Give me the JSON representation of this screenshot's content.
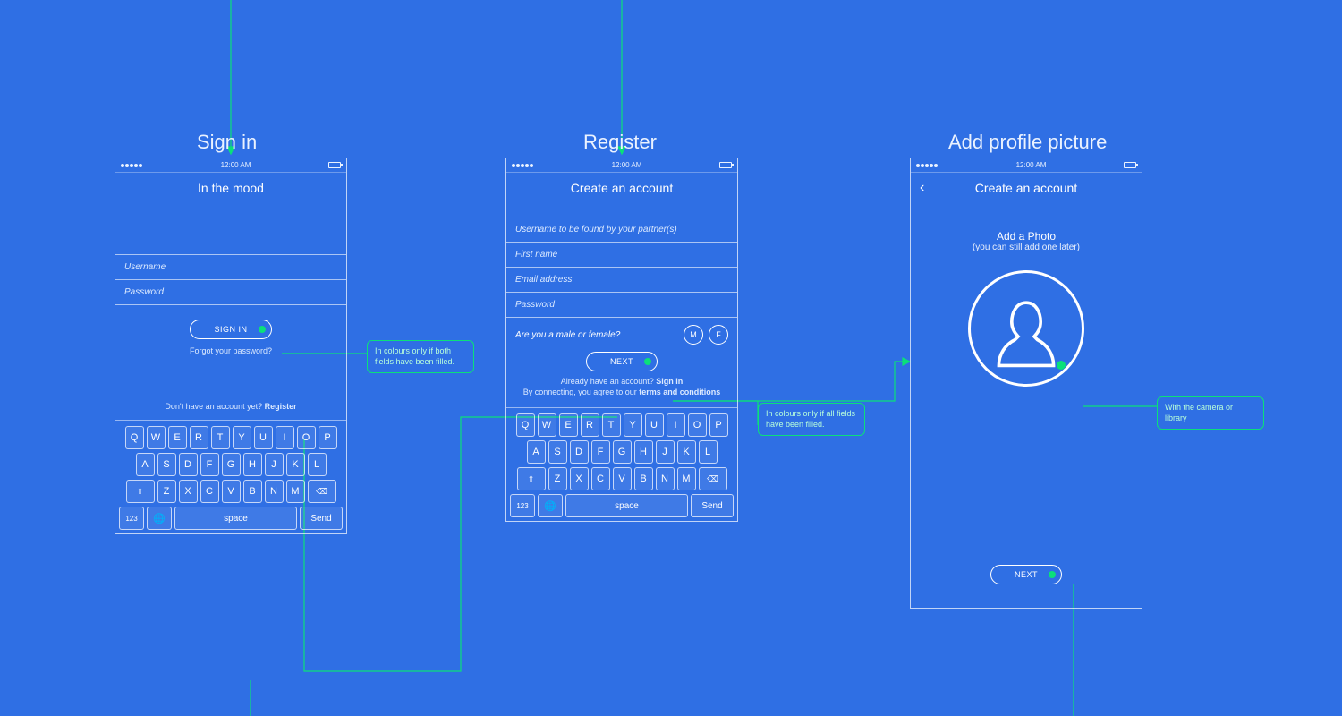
{
  "statusbar": {
    "time": "12:00 AM"
  },
  "screens": {
    "signin": {
      "title": "Sign in",
      "header": "In the mood",
      "fields": {
        "username": "Username",
        "password": "Password"
      },
      "signin_btn": "SIGN IN",
      "forgot": "Forgot your password?",
      "no_account_prefix": "Don't have an account yet? ",
      "no_account_link": "Register"
    },
    "register": {
      "title": "Register",
      "header": "Create an account",
      "fields": {
        "username": "Username to be found by your partner(s)",
        "firstname": "First name",
        "email": "Email address",
        "password": "Password"
      },
      "gender_q": "Are you a male or female?",
      "gender_m": "M",
      "gender_f": "F",
      "next_btn": "NEXT",
      "have_account_prefix": "Already have an account? ",
      "have_account_link": "Sign in",
      "terms_prefix": "By connecting, you agree to our ",
      "terms_link": "terms and conditions"
    },
    "photo": {
      "title": "Add profile picture",
      "header": "Create an account",
      "add_photo": "Add a Photo",
      "add_photo_sub": "(you can still add one later)",
      "next_btn": "NEXT"
    }
  },
  "keyboard": {
    "row1": [
      "Q",
      "W",
      "E",
      "R",
      "T",
      "Y",
      "U",
      "I",
      "O",
      "P"
    ],
    "row2": [
      "A",
      "S",
      "D",
      "F",
      "G",
      "H",
      "J",
      "K",
      "L"
    ],
    "row3_mid": [
      "Z",
      "X",
      "C",
      "V",
      "B",
      "N",
      "M"
    ],
    "shift": "⇧",
    "backspace": "⌫",
    "num": "123",
    "globe": "🌐",
    "space": "space",
    "send": "Send"
  },
  "annotations": {
    "signin_colour": "In colours only if both fields have been filled.",
    "register_colour": "In colours only if all fields have been filled.",
    "photo_source": "With the camera or library"
  }
}
